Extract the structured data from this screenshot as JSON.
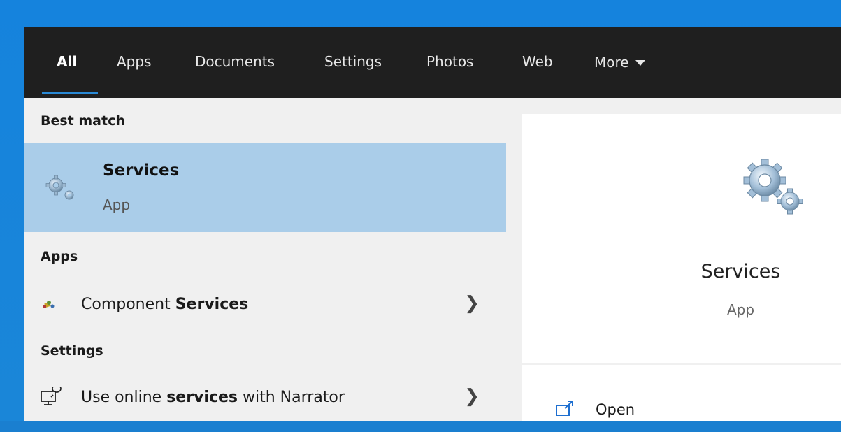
{
  "tabs": [
    {
      "label": "All",
      "active": true
    },
    {
      "label": "Apps"
    },
    {
      "label": "Documents"
    },
    {
      "label": "Settings"
    },
    {
      "label": "Photos"
    },
    {
      "label": "Web"
    },
    {
      "label": "More"
    }
  ],
  "results": {
    "best_match_label": "Best match",
    "best_match": {
      "title": "Services",
      "type": "App"
    },
    "apps_label": "Apps",
    "apps": [
      {
        "prefix": "Component ",
        "highlight": "Services",
        "suffix": ""
      }
    ],
    "settings_label": "Settings",
    "settings": [
      {
        "prefix": "Use online ",
        "highlight": "services",
        "suffix": " with Narrator"
      }
    ]
  },
  "preview": {
    "title": "Services",
    "type": "App",
    "actions": [
      {
        "label": "Open",
        "icon": "open-window-icon"
      }
    ]
  },
  "colors": {
    "tabbar_bg": "#1f1f1f",
    "accent": "#2a8ad6",
    "selected_row": "#aacde9"
  }
}
